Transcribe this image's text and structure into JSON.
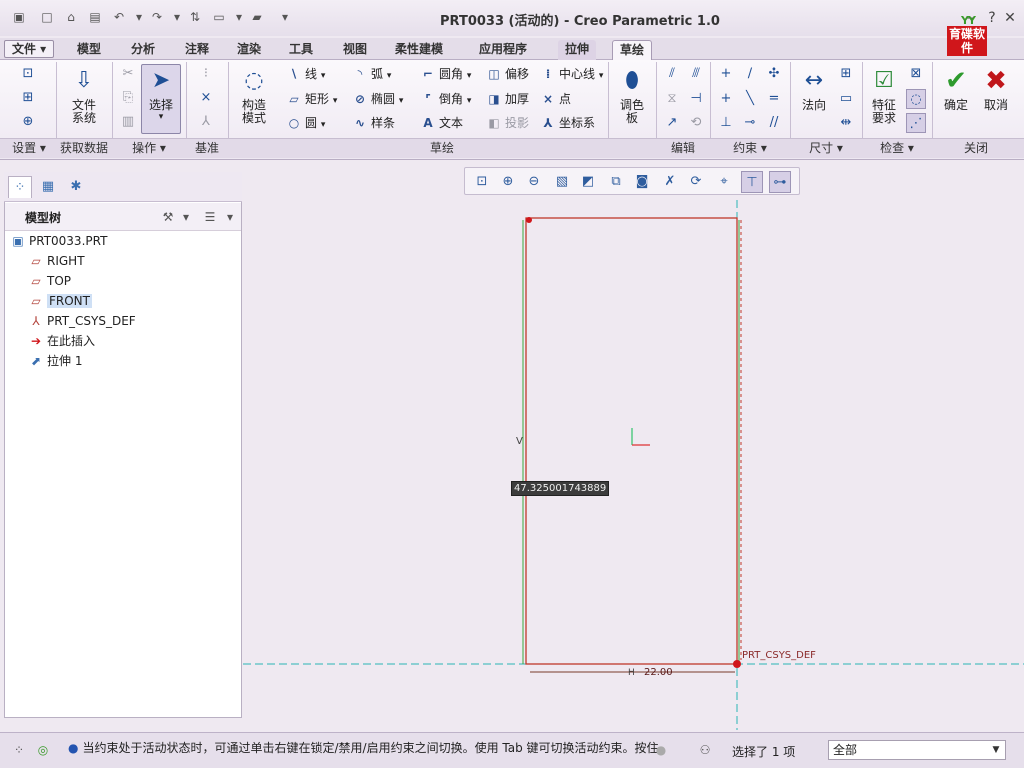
{
  "window": {
    "title": "PRT0033 (活动的) - Creo Parametric 1.0",
    "logo_text": "育碟软件",
    "logo_leaf": "YY"
  },
  "tabs": [
    {
      "label": "文件 ▾"
    },
    {
      "label": "模型"
    },
    {
      "label": "分析"
    },
    {
      "label": "注释"
    },
    {
      "label": "渲染"
    },
    {
      "label": "工具"
    },
    {
      "label": "视图"
    },
    {
      "label": "柔性建模"
    },
    {
      "label": "应用程序"
    },
    {
      "label": "拉伸"
    },
    {
      "label": "草绘"
    }
  ],
  "ribbon": {
    "groups": {
      "setup": "设置 ▾",
      "get_data": "获取数据",
      "operations": "操作 ▾",
      "datum": "基准",
      "sketch": "草绘",
      "edit": "编辑",
      "constrain": "约束 ▾",
      "dimension": "尺寸 ▾",
      "inspect": "检查 ▾",
      "close": "关闭"
    },
    "file_system": "文件\n系统",
    "select": "选择",
    "construction_mode": "构造\n模式",
    "palette": "调色\n板",
    "normal": "法向",
    "feature_requirements": "特征\n要求",
    "ok": "确定",
    "cancel": "取消",
    "sketch_items": {
      "line": "线",
      "rectangle": "矩形",
      "circle": "圆",
      "arc": "弧",
      "ellipse": "椭圆",
      "spline": "样条",
      "fillet": "圆角",
      "chamfer": "倒角",
      "text": "文本",
      "offset": "偏移",
      "thicken": "加厚",
      "project": "投影",
      "centerline": "中心线",
      "point": "点",
      "csys": "坐标系"
    }
  },
  "model_tree": {
    "header": "模型树",
    "items": [
      {
        "label": "PRT0033.PRT"
      },
      {
        "label": "RIGHT"
      },
      {
        "label": "TOP"
      },
      {
        "label": "FRONT"
      },
      {
        "label": "PRT_CSYS_DEF"
      },
      {
        "label": "在此插入"
      },
      {
        "label": "拉伸 1"
      }
    ]
  },
  "graphics": {
    "dimension_tooltip": "47.325001743889",
    "dimension_bottom": "22.00",
    "csys_label": "PRT_CSYS_DEF",
    "vertical_mark": "V",
    "horizontal_mark": "H"
  },
  "status": {
    "message": "当约束处于活动状态时，可通过单击右键在锁定/禁用/启用约束之间切换。使用 Tab 键可切换活动约束。按住",
    "selected": "选择了 1 项",
    "filter_value": "全部"
  },
  "colors": {
    "accent": "#1f4f95",
    "sketch_line": "#c0392b",
    "dashed_axis": "#2bb5b5",
    "bg": "#efe9f1"
  }
}
